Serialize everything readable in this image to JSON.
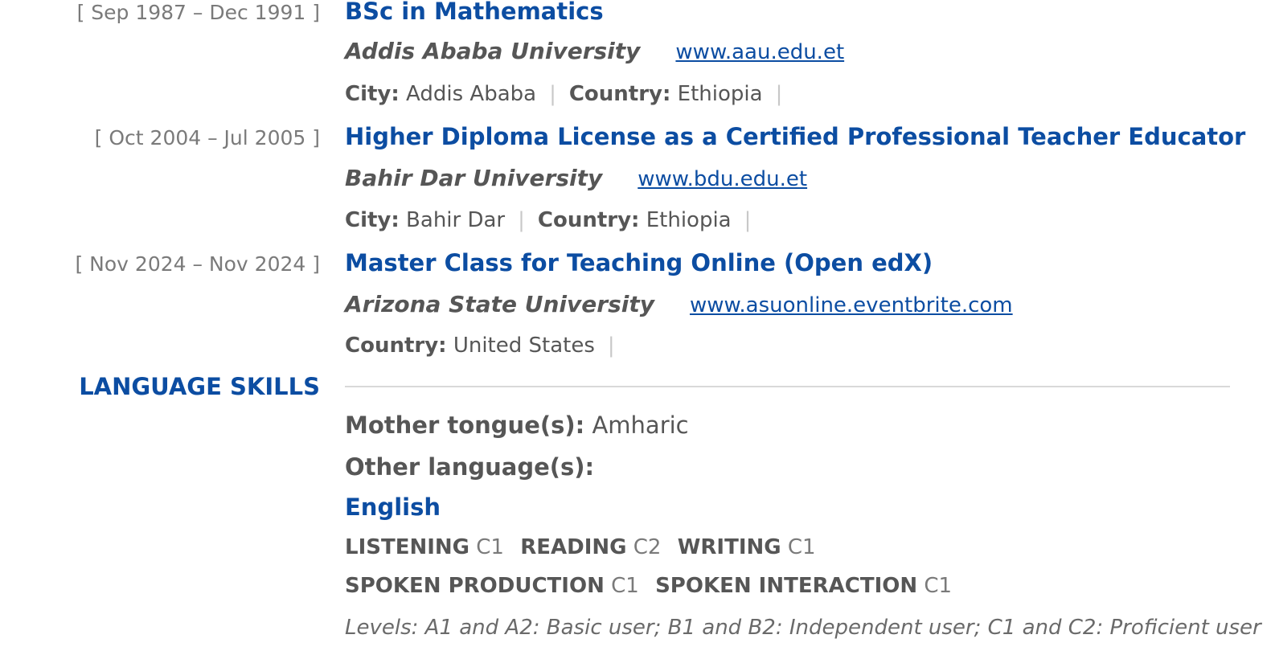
{
  "education": [
    {
      "date": "[ Sep 1987 – Dec 1991 ]",
      "title": "BSc in Mathematics",
      "organisation": "Addis Ababa University",
      "url": "www.aau.edu.et",
      "city_label": "City:",
      "city": "Addis Ababa",
      "country_label": "Country:",
      "country": "Ethiopia",
      "separator": "|"
    },
    {
      "date": "[ Oct 2004 – Jul 2005 ]",
      "title": "Higher Diploma License as a Certified Professional Teacher Educator",
      "organisation": "Bahir Dar University",
      "url": "www.bdu.edu.et",
      "city_label": "City:",
      "city": "Bahir Dar",
      "country_label": "Country:",
      "country": "Ethiopia",
      "separator": "|"
    },
    {
      "date": "[ Nov 2024 – Nov 2024 ]",
      "title": "Master Class for Teaching Online (Open edX)",
      "organisation": "Arizona State University",
      "url": "www.asuonline.eventbrite.com",
      "country_label": "Country:",
      "country": "United States",
      "separator": "|"
    }
  ],
  "language_skills": {
    "heading": "LANGUAGE SKILLS",
    "mother_tongue_label": "Mother tongue(s):",
    "mother_tongue": "Amharic",
    "other_label": "Other language(s):",
    "languages": [
      {
        "name": "English",
        "listening_label": "LISTENING",
        "listening": "C1",
        "reading_label": "READING",
        "reading": "C2",
        "writing_label": "WRITING",
        "writing": "C1",
        "spoken_production_label": "SPOKEN PRODUCTION",
        "spoken_production": "C1",
        "spoken_interaction_label": "SPOKEN INTERACTION",
        "spoken_interaction": "C1"
      }
    ],
    "levels_note": "Levels: A1 and A2: Basic user; B1 and B2: Independent user; C1 and C2: Proficient user"
  },
  "colors": {
    "accent": "#0c4da2",
    "text": "#565656",
    "muted": "#7a7a7a",
    "rule": "#d9d9d9"
  }
}
